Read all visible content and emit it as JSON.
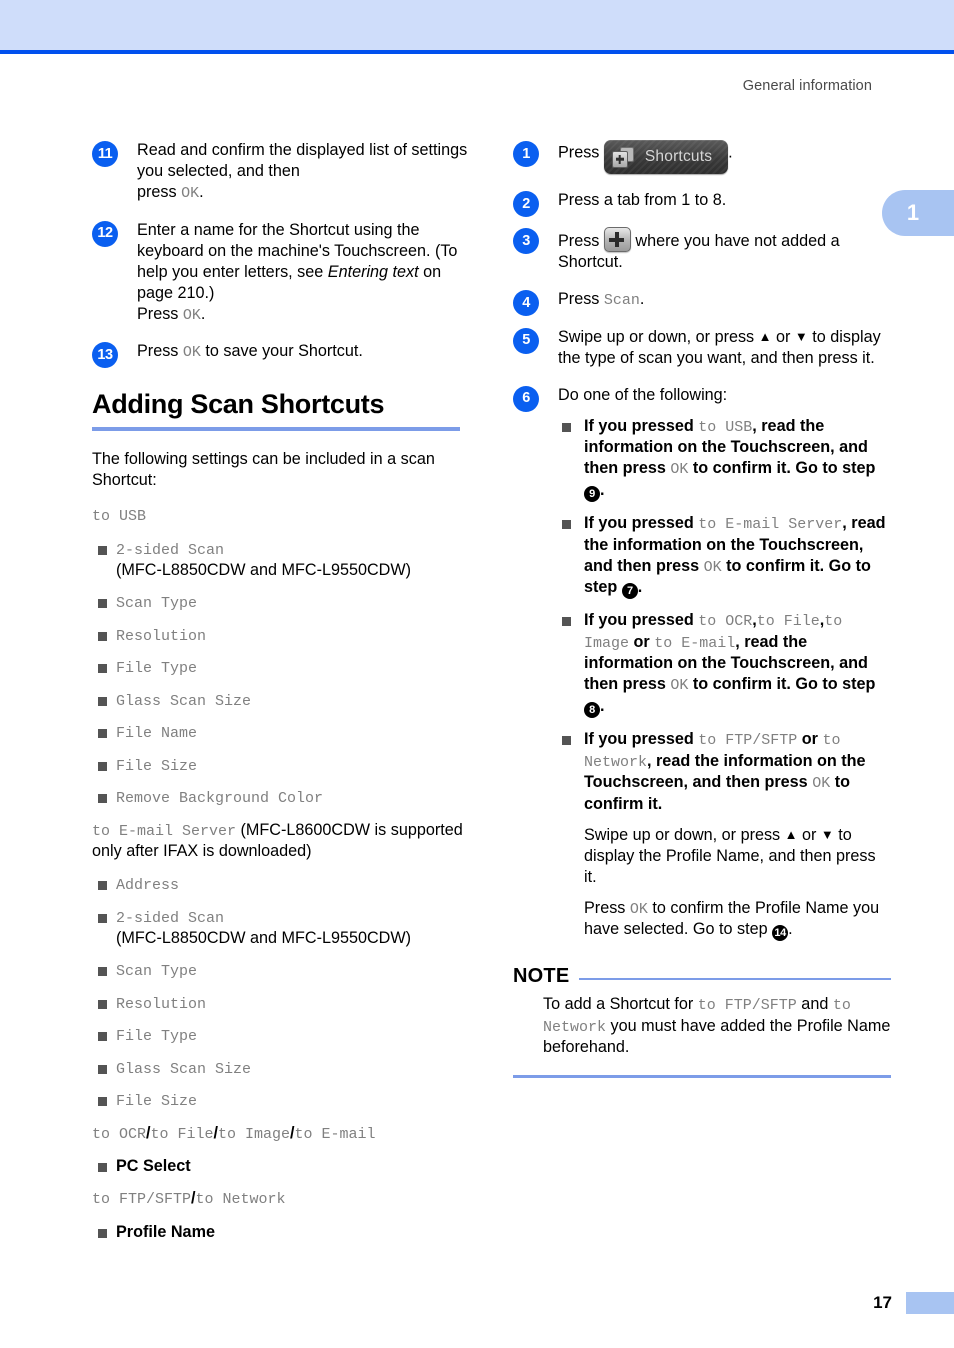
{
  "header": {
    "running_title": "General information",
    "chapter_tab": "1"
  },
  "footer": {
    "page_number": "17"
  },
  "colors": {
    "band": "#cfddfa",
    "band_rule": "#0050ee",
    "step_circle": "#0a5ff0",
    "heading_rule": "#7c9ce8",
    "tab": "#a8c4f2",
    "mono_text": "#808080",
    "bullet": "#545454"
  },
  "left_column": {
    "steps": [
      {
        "num": "11",
        "line1": "Read and confirm the displayed list of settings you selected, and then",
        "line2_prefix": "press ",
        "line2_mono": "OK",
        "line2_suffix": "."
      },
      {
        "num": "12",
        "line1": "Enter a name for the Shortcut using the keyboard on the machine's Touchscreen. (To help you enter letters, see ",
        "italic": "Entering text",
        "line1_cont": " on page 210.)",
        "line2_prefix": "Press ",
        "line2_mono": "OK",
        "line2_suffix": "."
      },
      {
        "num": "13",
        "line1_prefix": "Press ",
        "line1_mono": "OK",
        "line1_suffix": " to save your Shortcut."
      }
    ],
    "section_heading": "Adding Scan Shortcuts",
    "intro": "The following settings can be included in a scan Shortcut:",
    "groups": [
      {
        "label_mono": "to USB",
        "label_plain": "",
        "items": [
          {
            "mono": "2-sided Scan",
            "plain": "(MFC-L8850CDW and MFC-L9550CDW)",
            "break": true
          },
          {
            "mono": "Scan Type",
            "plain": ""
          },
          {
            "mono": "Resolution",
            "plain": ""
          },
          {
            "mono": "File Type",
            "plain": ""
          },
          {
            "mono": "Glass Scan Size",
            "plain": ""
          },
          {
            "mono": "File Name",
            "plain": ""
          },
          {
            "mono": "File Size",
            "plain": ""
          },
          {
            "mono": "Remove Background Color",
            "plain": ""
          }
        ]
      },
      {
        "label_mono": "to E-mail Server",
        "label_plain": " (MFC-L8600CDW is supported only after IFAX is downloaded)",
        "items": [
          {
            "mono": "Address",
            "plain": ""
          },
          {
            "mono": "2-sided Scan",
            "plain": "(MFC-L8850CDW and MFC-L9550CDW)",
            "break": true
          },
          {
            "mono": "Scan Type",
            "plain": ""
          },
          {
            "mono": "Resolution",
            "plain": ""
          },
          {
            "mono": "File Type",
            "plain": ""
          },
          {
            "mono": "Glass Scan Size",
            "plain": ""
          },
          {
            "mono": "File Size",
            "plain": ""
          }
        ]
      }
    ],
    "group3": {
      "parts": [
        "to OCR",
        "to File",
        "to Image",
        "to E-mail"
      ],
      "item_bold": "PC Select"
    },
    "group4": {
      "parts": [
        "to FTP/SFTP",
        "to Network"
      ],
      "item_bold": "Profile Name"
    }
  },
  "right_column": {
    "steps": [
      {
        "num": "1",
        "text_before": "Press ",
        "button_label": "Shortcuts",
        "text_after": "."
      },
      {
        "num": "2",
        "text": "Press a tab from 1 to 8."
      },
      {
        "num": "3",
        "text_before": "Press ",
        "text_after": " where you have not added a Shortcut."
      },
      {
        "num": "4",
        "text_before": "Press ",
        "mono": "Scan",
        "text_after": "."
      },
      {
        "num": "5",
        "text_a": "Swipe up or down, or press ",
        "up": "▲",
        "text_b": " or ",
        "down": "▼",
        "text_c": " to display the type of scan you want, and then press it."
      },
      {
        "num": "6",
        "text": "Do one of the following:"
      }
    ],
    "sub_bullets": [
      {
        "a": "If you pressed ",
        "mono1": "to USB",
        "b": ", read the information on the Touchscreen, and then press ",
        "mono2": "OK",
        "c": " to confirm it. Go to step ",
        "ref": "9",
        "d": "."
      },
      {
        "a": "If you pressed ",
        "mono1": "to E-mail Server",
        "b": ", read the information on the Touchscreen, and then press ",
        "mono2": "OK",
        "c": " to confirm it. Go to step ",
        "ref": "7",
        "d": "."
      },
      {
        "a": "If you pressed ",
        "mono1": "to OCR",
        "sep1": ",",
        "mono2": "to File",
        "sep2": ",",
        "mono3": "to Image",
        "b": " or ",
        "mono4": "to E-mail",
        "c": ", read the information on the Touchscreen, and then press ",
        "mono5": "OK",
        "d": " to confirm it. Go to step ",
        "ref": "8",
        "e": "."
      },
      {
        "a": "If you pressed ",
        "mono1": "to FTP/SFTP",
        "b": " or ",
        "mono2": "to Network",
        "c": ", read the information on the Touchscreen, and then press ",
        "mono3": "OK",
        "d": " to confirm it.",
        "para2_a": "Swipe up or down, or press ",
        "para2_up": "▲",
        "para2_b": " or ",
        "para2_down": "▼",
        "para2_c": " to display the Profile Name, and then press it.",
        "para3_a": "Press ",
        "para3_mono": "OK",
        "para3_b": " to confirm the Profile Name you have selected. Go to step ",
        "para3_ref": "14",
        "para3_c": "."
      }
    ],
    "note": {
      "title": "NOTE",
      "a": "To add a Shortcut for ",
      "mono1": "to FTP/SFTP",
      "b": " and ",
      "mono2": "to Network",
      "c": " you must have added the Profile Name beforehand."
    }
  }
}
